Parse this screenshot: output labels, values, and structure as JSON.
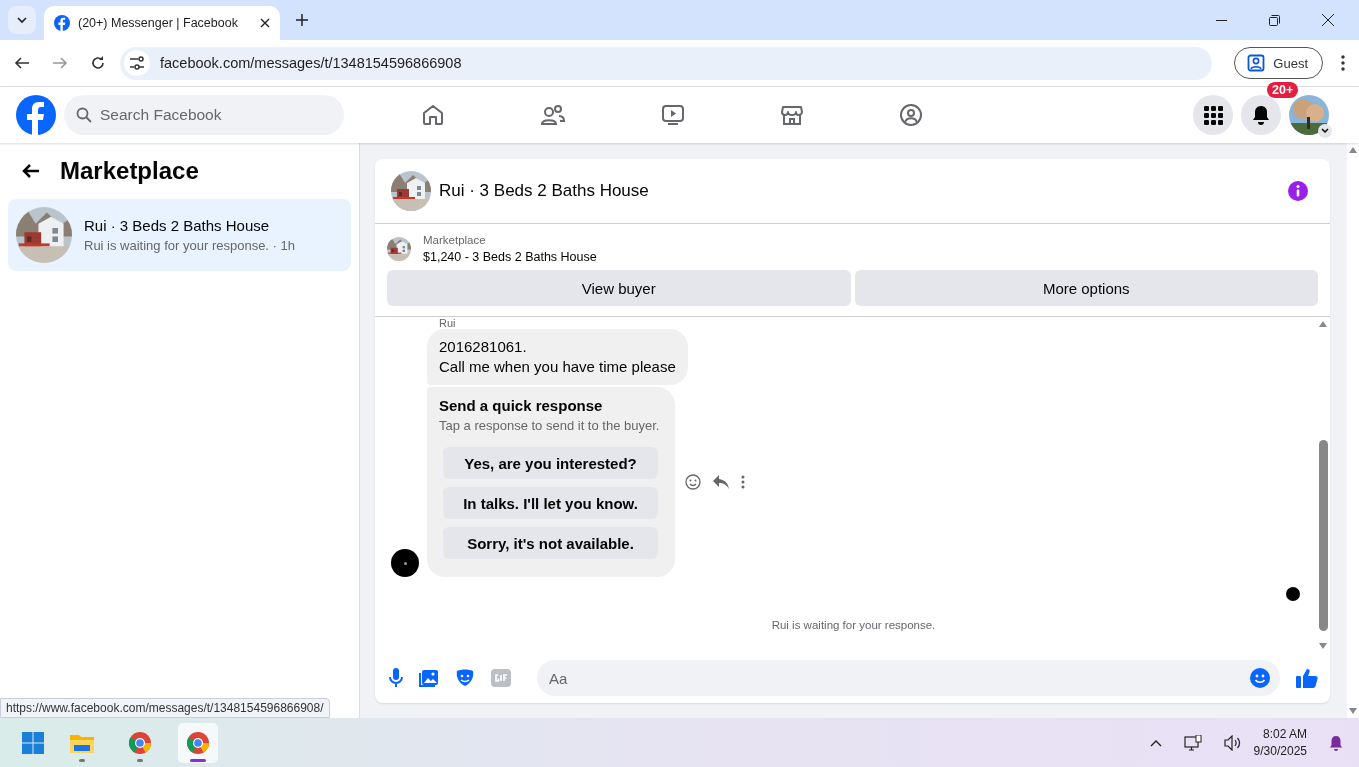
{
  "browser": {
    "tabs": [
      {
        "title": "(20+) Messenger | Facebook",
        "selected": true
      }
    ],
    "address": "facebook.com/messages/t/1348154596866908",
    "profile": "Guest"
  },
  "header": {
    "search_placeholder": "Search Facebook",
    "notification_badge": "20+"
  },
  "sidebar": {
    "title": "Marketplace",
    "conversations": [
      {
        "name": "Rui · 3 Beds 2 Baths House",
        "preview": "Rui is waiting for your response. · 1h",
        "selected": true
      }
    ]
  },
  "chat": {
    "title": "Rui · 3 Beds 2 Baths House",
    "listing": {
      "label": "Marketplace",
      "title": "$1,240 - 3 Beds 2 Baths House"
    },
    "actions": [
      "View buyer",
      "More options"
    ],
    "sender": "Rui",
    "message_lines": [
      "2016281061.",
      "Call me when you have time please"
    ],
    "quick_response": {
      "title": "Send a quick response",
      "subtitle": "Tap a response to send it to the buyer.",
      "options": [
        "Yes, are you interested?",
        "In talks. I'll let you know.",
        "Sorry, it's not available."
      ]
    },
    "status": "Rui is waiting for your response.",
    "composer_placeholder": "Aa"
  },
  "status_url": "https://www.facebook.com/messages/t/1348154596866908/",
  "taskbar": {
    "apps": [
      {
        "kind": "files",
        "selected": false
      },
      {
        "kind": "chrome",
        "selected": false
      },
      {
        "kind": "chrome",
        "selected": true
      }
    ],
    "time": "8:02 AM",
    "date": "9/30/2025"
  }
}
